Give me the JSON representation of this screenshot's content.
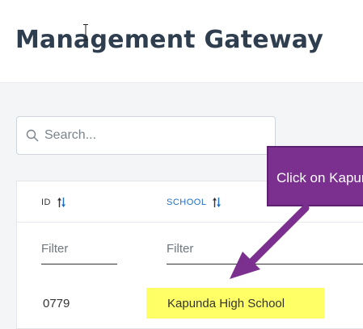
{
  "header": {
    "title": "Management Gateway"
  },
  "search": {
    "placeholder": "Search..."
  },
  "table": {
    "columns": [
      {
        "label": "ID",
        "sortable": true
      },
      {
        "label": "SCHOOL",
        "sortable": true
      }
    ],
    "filters": {
      "placeholder": "Filter"
    },
    "rows": [
      {
        "id": "0779",
        "school": "Kapunda High School"
      }
    ]
  },
  "callout": {
    "text": "Click on Kapunda High School",
    "color": "#7b2f8e"
  },
  "colors": {
    "highlight": "#ffff66",
    "link": "#1b6ec2",
    "title": "#2f3e4f"
  },
  "icons": {
    "search": "search-icon",
    "sort": "sort-arrows-icon",
    "cursor": "text-cursor-icon",
    "arrow": "callout-arrow"
  }
}
